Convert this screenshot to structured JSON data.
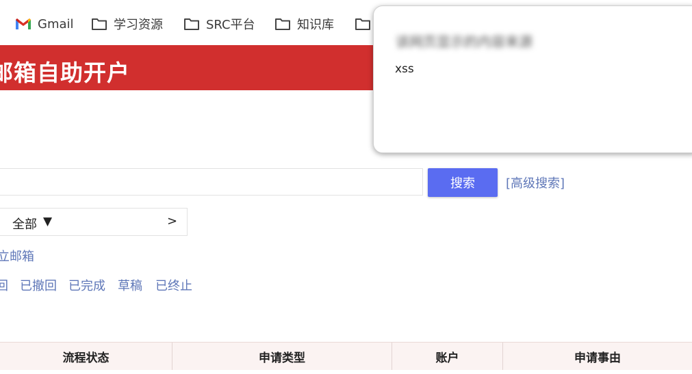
{
  "bookmarks": [
    {
      "label": "Gmail",
      "icon": "gmail-icon"
    },
    {
      "label": "学习资源",
      "icon": "folder-icon"
    },
    {
      "label": "SRC平台",
      "icon": "folder-icon"
    },
    {
      "label": "知识库",
      "icon": "folder-icon"
    },
    {
      "label": "",
      "icon": "folder-icon"
    }
  ],
  "header": {
    "title": "邮箱自助开户",
    "visible_title": "邮箱自助开户"
  },
  "search": {
    "button_label": "搜索",
    "advanced_label": "[高级搜索]",
    "placeholder": ""
  },
  "filter": {
    "selected": "全部",
    "caret": "▼",
    "next": ">"
  },
  "links": {
    "unit_mail": "立邮箱"
  },
  "status_tabs": [
    "回",
    "已撤回",
    "已完成",
    "草稿",
    "已终止"
  ],
  "table": {
    "headers": [
      "流程状态",
      "申请类型",
      "账户",
      "申请事由"
    ]
  },
  "dialog": {
    "origin": "该网页显示的内容来源",
    "message": "xss"
  },
  "colors": {
    "header_red": "#d12f2e",
    "button_blue": "#5a6cf1",
    "link_blue": "#5f77b8"
  }
}
